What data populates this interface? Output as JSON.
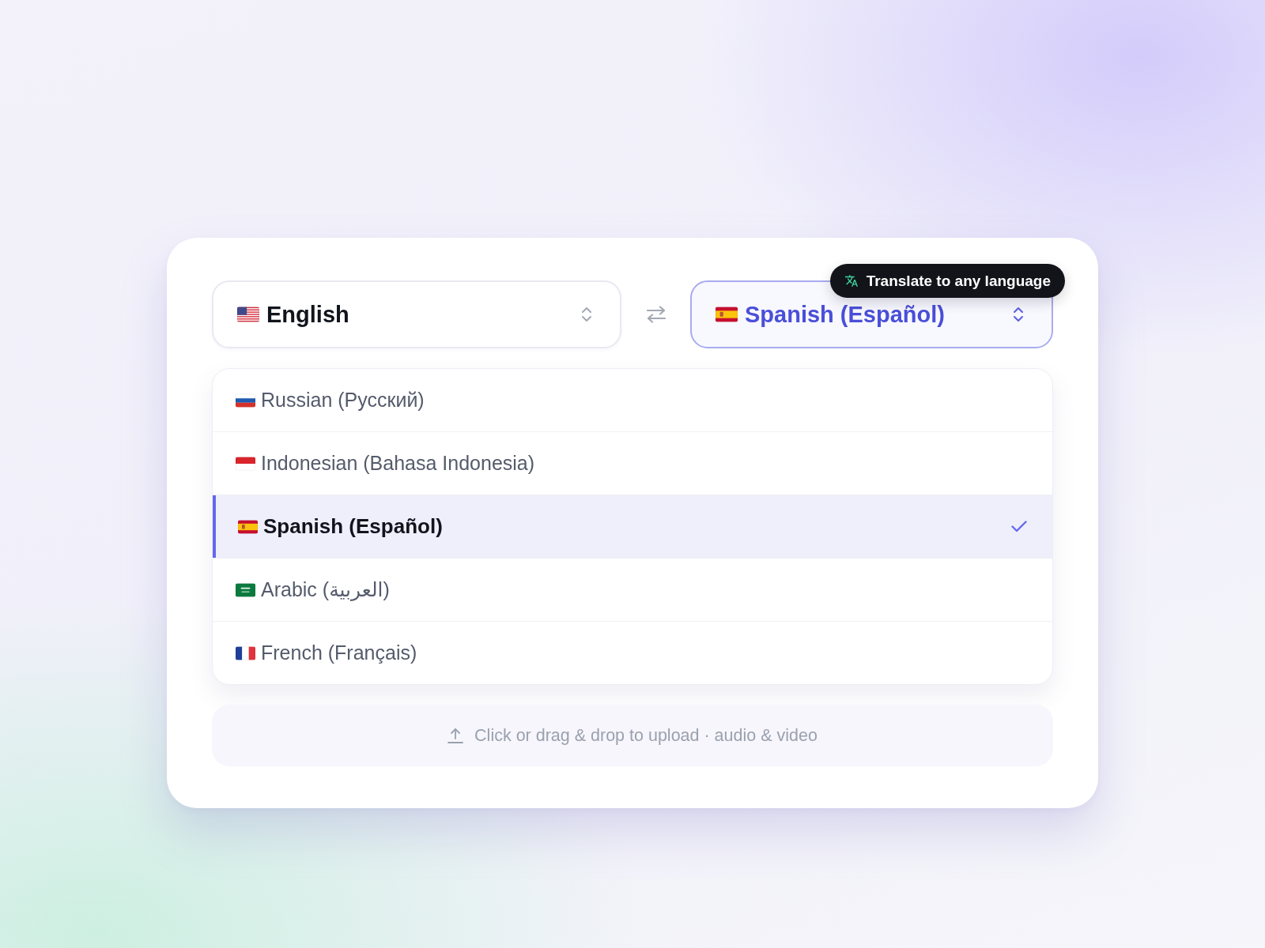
{
  "source": {
    "kind": "us",
    "label": "English",
    "expanded": false
  },
  "target": {
    "kind": "es",
    "label": "Spanish (Español)",
    "expanded": true
  },
  "tooltip": {
    "text": "Translate to any language"
  },
  "languages": [
    {
      "kind": "ru",
      "label": "Russian (Русский)",
      "selected": false
    },
    {
      "kind": "id",
      "label": "Indonesian (Bahasa Indonesia)",
      "selected": false
    },
    {
      "kind": "es",
      "label": "Spanish (Español)",
      "selected": true
    },
    {
      "kind": "sa",
      "label": "Arabic (العربية)",
      "selected": false
    },
    {
      "kind": "fr",
      "label": "French (Français)",
      "selected": false
    }
  ],
  "upload": {
    "text": "Click or drag & drop to upload · audio & video"
  }
}
